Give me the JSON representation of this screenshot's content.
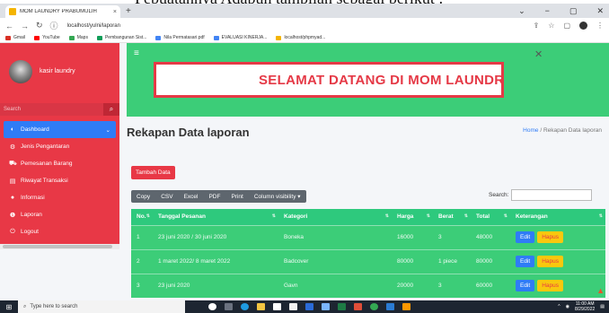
{
  "caption_text": "Pebuatannya Adapun tampilan sebagai berikut :",
  "browser": {
    "tab_title": "MOM LAUNDRY PRABUMULIH",
    "tab_close": "×",
    "new_tab": "+",
    "url": "localhost/yulni/laporan",
    "window_controls": [
      "⌄",
      "−",
      "▢",
      "✕"
    ],
    "bookmarks": [
      {
        "label": "Gmail",
        "color": "#d93025"
      },
      {
        "label": "YouTube",
        "color": "#ff0000"
      },
      {
        "label": "Maps",
        "color": "#34a853"
      },
      {
        "label": "Pembangunan Sist...",
        "color": "#0f9d58"
      },
      {
        "label": "Nila Permatasari.pdf",
        "color": "#4285f4"
      },
      {
        "label": "EVALUASI KINERJA...",
        "color": "#4285f4"
      },
      {
        "label": "localhost/phpmyad...",
        "color": "#f4b400"
      }
    ]
  },
  "sidebar": {
    "brand_name": "kasir laundry",
    "search_placeholder": "Search",
    "items": [
      {
        "label": "Dashboard",
        "icon": "dashboard-icon",
        "glyph": "◐",
        "active": true,
        "caret": "⌄"
      },
      {
        "label": "Jenis Pengantaran",
        "icon": "delivery-icon",
        "glyph": "⚙",
        "active": false
      },
      {
        "label": "Pemesanan Barang",
        "icon": "cart-icon",
        "glyph": "⛟",
        "active": false
      },
      {
        "label": "Riwayat Transaksi",
        "icon": "history-icon",
        "glyph": "▤",
        "active": false
      },
      {
        "label": "Informasi",
        "icon": "user-icon",
        "glyph": "●",
        "active": false
      },
      {
        "label": "Laporan",
        "icon": "info-icon",
        "glyph": "❶",
        "active": false
      },
      {
        "label": "Logout",
        "icon": "power-icon",
        "glyph": "⏻",
        "active": false
      }
    ]
  },
  "header": {
    "welcome": "SELAMAT DATANG DI MOM LAUNDR"
  },
  "content": {
    "title": "Rekapan Data laporan",
    "breadcrumb_home": "Home",
    "breadcrumb_sep": "/",
    "breadcrumb_current": "Rekapan Data laporan",
    "add_button": "Tambah Data",
    "export_buttons": [
      "Copy",
      "CSV",
      "Excel",
      "PDF",
      "Print",
      "Column visibility ▾"
    ],
    "search_label": "Search:"
  },
  "table": {
    "columns": [
      "No.",
      "Tanggal Pesanan",
      "Kategori",
      "Harga",
      "Berat",
      "Total",
      "Keterangan"
    ],
    "rows": [
      [
        "1",
        "23 juni 2020 / 30 juni 2020",
        "Boneka",
        "16000",
        "3",
        "48000"
      ],
      [
        "2",
        "1 maret 2022/ 8 maret 2022",
        "Badcover",
        "80000",
        "1 piece",
        "80000"
      ],
      [
        "3",
        "23 juni 2020",
        "Gavn",
        "20000",
        "3",
        "60000"
      ]
    ],
    "edit_label": "Edit",
    "delete_label": "Hapus"
  },
  "taskbar": {
    "search_placeholder": "Type here to search",
    "time": "11:00 AM",
    "date": "8/29/2022"
  },
  "colors": {
    "sidebar": "#e83846",
    "topbar": "#3ccd78",
    "accent_blue": "#2f7cf6",
    "delete_yellow": "#f9c80e"
  }
}
